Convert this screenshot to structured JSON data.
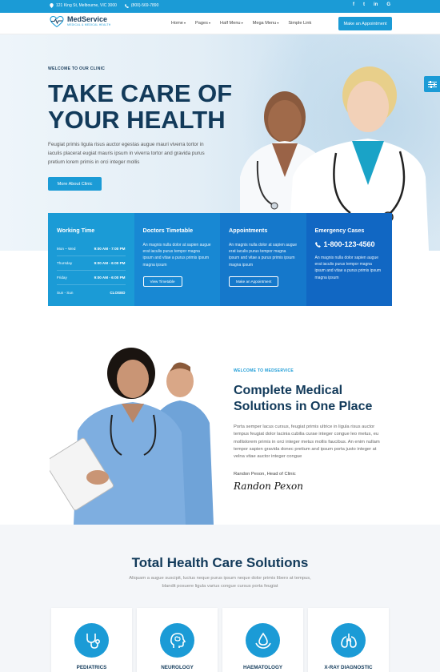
{
  "topbar": {
    "address": "121 King St, Melbourne, VIC 3000",
    "phone": "(800)-569-7890",
    "social": [
      "f",
      "t",
      "in",
      "G"
    ]
  },
  "header": {
    "logo_name": "MedService",
    "logo_sub": "MEDICAL & MEDICAL HEALTH",
    "nav": [
      "Home",
      "Pages",
      "Half Menu",
      "Mega Menu",
      "Simple Link"
    ],
    "cta": "Make an Appointment"
  },
  "hero": {
    "eyebrow": "WELCOME TO OUR CLINIC",
    "title_line1": "TAKE CARE OF",
    "title_line2": "YOUR HEALTH",
    "text": "Feugiat primis ligula risus auctor egestas augue mauri viverra tortor in iaculis placerat eugiat mauris ipsum in viverra tortor and gravida purus pretium lorem primis in orci integer mollis",
    "button": "More About Clinic"
  },
  "cards": {
    "working": {
      "title": "Working Time",
      "rows": [
        {
          "day": "Mon – Wed",
          "time": "9:00 AM - 7:00 PM"
        },
        {
          "day": "Thursday",
          "time": "9:00 AM - 6:00 PM"
        },
        {
          "day": "Friday",
          "time": "9:00 AM - 6:00 PM"
        },
        {
          "day": "Sun - Sun",
          "time": "CLOSED"
        }
      ]
    },
    "doctors": {
      "title": "Doctors Timetable",
      "text": "An magnis nulla dolor at sapien augue erat iaculis purus tempor magna ipsum and vitae a purus primis ipsum magna ipsum",
      "button": "View Timetable"
    },
    "appointments": {
      "title": "Appointments",
      "text": "An magnis nulla dolor at sapien augue erat iaculis purus tempor magna ipsum and vitae a purus primis ipsum magna ipsum",
      "button": "Make an Appointment"
    },
    "emergency": {
      "title": "Emergency Cases",
      "phone": "1-800-123-4560",
      "text": "An magnis nulla dolor sapien augue erat iaculis purus tempor magna ipsum and vitae a purus primis ipsum magna ipsum"
    }
  },
  "about": {
    "eyebrow": "WELCOME TO MEDSERVICE",
    "title": "Complete Medical Solutions in One Place",
    "text": "Porta semper lacus cursus, feugiat primis ultrice in ligula risus auctor tempus feugiat dolor lacinia cubilia curae integer congue leo metus, eu mollislorem primis in orci integer metus mollis faucibus. An enim nullam tempor sapien gravida donec pretium and ipsum porta justo integer at velna vitae auctor integer congue",
    "signer": "Randon Pexon, Head of Clinic",
    "signature": "Randon Pexon"
  },
  "services": {
    "title": "Total Health Care Solutions",
    "text": "Aliquam a augue suscipit, luctus neque purus ipsum neque dolor primis libero at tempus, blandit posuere ligula varius congue cursus porta feugiat",
    "items": [
      {
        "label": "PEDIATRICS",
        "icon": "stethoscope-icon"
      },
      {
        "label": "NEUROLOGY",
        "icon": "brain-head-icon"
      },
      {
        "label": "HAEMATOLOGY",
        "icon": "blood-drop-icon"
      },
      {
        "label": "X-RAY DIAGNOSTIC",
        "icon": "lungs-icon"
      }
    ]
  },
  "colors": {
    "primary": "#1b9bd6",
    "dark_navy": "#123a5a",
    "card_shades": [
      "#1b9bd6",
      "#1888d3",
      "#1578cb",
      "#1167c3"
    ]
  }
}
